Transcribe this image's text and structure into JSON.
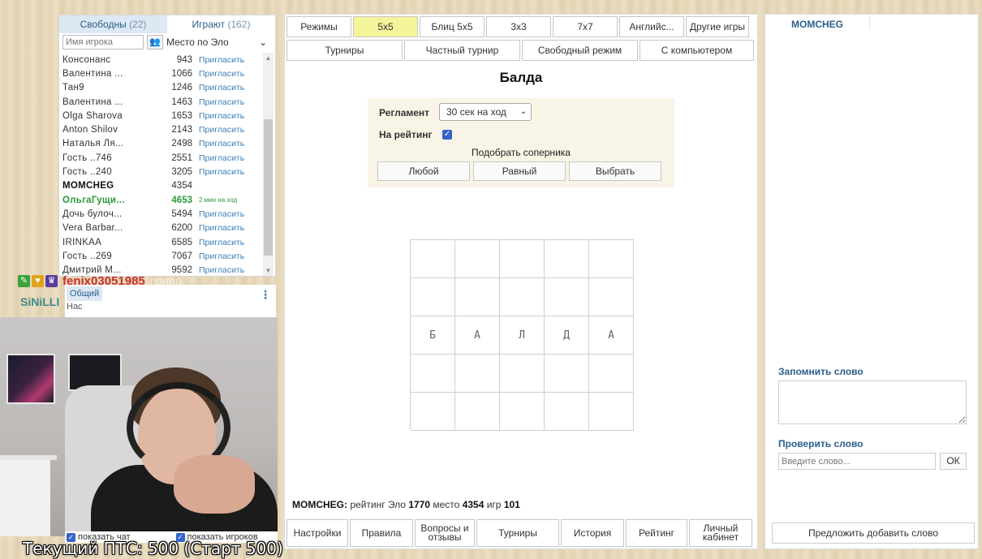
{
  "players_panel": {
    "tab_free": "Свободны",
    "tab_free_count": "(22)",
    "tab_playing": "Играют",
    "tab_playing_count": "(162)",
    "search_placeholder": "Имя игрока",
    "sort_label": "Место по Эло",
    "players": [
      {
        "name": "Консонанс",
        "rating": "943",
        "action": "Пригласить",
        "state": ""
      },
      {
        "name": "Валентина ...",
        "rating": "1066",
        "action": "Пригласить",
        "state": ""
      },
      {
        "name": "Тан9",
        "rating": "1246",
        "action": "Пригласить",
        "state": ""
      },
      {
        "name": "Валентина ...",
        "rating": "1463",
        "action": "Пригласить",
        "state": ""
      },
      {
        "name": "Olga Sharova",
        "rating": "1653",
        "action": "Пригласить",
        "state": ""
      },
      {
        "name": "Anton Shilov",
        "rating": "2143",
        "action": "Пригласить",
        "state": ""
      },
      {
        "name": "Наталья Ля...",
        "rating": "2498",
        "action": "Пригласить",
        "state": ""
      },
      {
        "name": "Гость ..746",
        "rating": "2551",
        "action": "Пригласить",
        "state": ""
      },
      {
        "name": "Гость ..240",
        "rating": "3205",
        "action": "Пригласить",
        "state": ""
      },
      {
        "name": "MOMCHEG",
        "rating": "4354",
        "action": "",
        "state": "me"
      },
      {
        "name": "ОльгаГущи...",
        "rating": "4653",
        "action": "2 мин на ход",
        "state": "playing"
      },
      {
        "name": "Дочь булоч...",
        "rating": "5494",
        "action": "Пригласить",
        "state": ""
      },
      {
        "name": "Vera Barbar...",
        "rating": "6200",
        "action": "Пригласить",
        "state": ""
      },
      {
        "name": "IRINKAA",
        "rating": "6585",
        "action": "Пригласить",
        "state": ""
      },
      {
        "name": "Гость ..269",
        "rating": "7067",
        "action": "Пригласить",
        "state": ""
      },
      {
        "name": "Дмитрий М...",
        "rating": "9592",
        "action": "Пригласить",
        "state": ""
      }
    ]
  },
  "stream_overlay": {
    "chat_user1": "fenix03051985",
    "chat_user1_suffix": "понял",
    "chat_user2": "SiNiLLI",
    "chat_tab": "Общий",
    "chat_preview": "Нас",
    "show_chat": "показать чат",
    "show_players": "показать игроков",
    "caption": "Текущий ПТС: 500 (Старт 500)"
  },
  "game": {
    "mode_tabs": [
      "Режимы",
      "5x5",
      "Блиц 5x5",
      "3x3",
      "7x7",
      "Английс...",
      "Другие игры"
    ],
    "mode_tabs_second": [
      "Турниры",
      "Частный турнир",
      "Свободный режим",
      "С компьютером"
    ],
    "title": "Балда",
    "reglament_label": "Регламент",
    "reglament_value": "30 сек на ход",
    "rated_label": "На рейтинг",
    "find_opponent": "Подобрать соперника",
    "opponent_buttons": [
      "Любой",
      "Равный",
      "Выбрать"
    ],
    "board": [
      [
        "",
        "",
        "",
        "",
        ""
      ],
      [
        "",
        "",
        "",
        "",
        ""
      ],
      [
        "Б",
        "А",
        "Л",
        "Д",
        "А"
      ],
      [
        "",
        "",
        "",
        "",
        ""
      ],
      [
        "",
        "",
        "",
        "",
        ""
      ]
    ],
    "stats": {
      "user": "MOMCHEG:",
      "elo_label": "рейтинг Эло",
      "elo": "1770",
      "place_label": "место",
      "place": "4354",
      "games_label": "игр",
      "games": "101"
    },
    "bottom_buttons": [
      "Настройки",
      "Правила",
      "Вопросы и отзывы",
      "Турниры",
      "История",
      "Рейтинг",
      "Личный кабинет"
    ]
  },
  "right_panel": {
    "username": "MOMCHEG",
    "remember_word": "Запомнить слово",
    "check_word": "Проверить слово",
    "check_placeholder": "Введите слово...",
    "ok": "ОК",
    "suggest_word": "Предложить добавить слово"
  },
  "colors": {
    "accent_blue": "#2b5f8a",
    "highlight_yellow": "#f4f49a",
    "playing_green": "#2a9a3a",
    "caption_white": "#ffffff"
  }
}
